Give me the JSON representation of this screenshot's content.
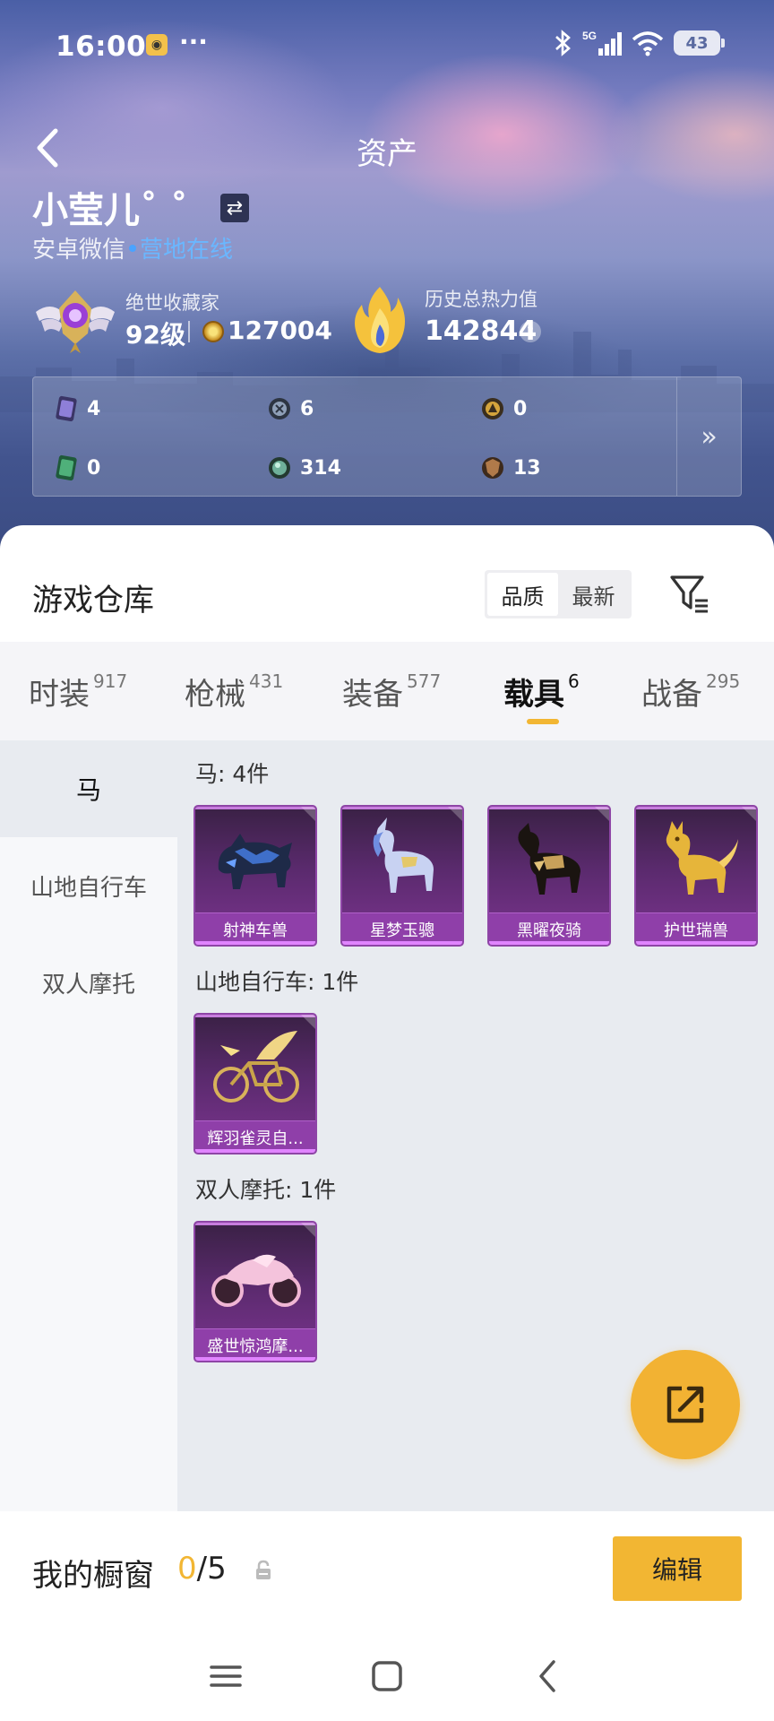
{
  "status_bar": {
    "time": "16:00",
    "dots": "···",
    "battery": "43",
    "network": "5G"
  },
  "header": {
    "title": "资产",
    "username": "小莹儿˚ ˚",
    "platform": "安卓微信",
    "online_status": "营地在线",
    "rank_title": "绝世收藏家",
    "level": "92级",
    "coins": "127004",
    "heat_label": "历史总热力值",
    "heat_value": "142844",
    "help": "?"
  },
  "assets": [
    {
      "icon": "purple-card-icon",
      "value": "4"
    },
    {
      "icon": "silver-emblem-icon",
      "value": "6"
    },
    {
      "icon": "gold-emblem-icon",
      "value": "0"
    },
    {
      "icon": "green-card-icon",
      "value": "0"
    },
    {
      "icon": "green-orb-icon",
      "value": "314"
    },
    {
      "icon": "bronze-shield-icon",
      "value": "13"
    }
  ],
  "assets_more": "»",
  "warehouse": {
    "title": "游戏仓库",
    "sort_options": [
      "品质",
      "最新"
    ],
    "sort_selected": "品质"
  },
  "tabs": [
    {
      "label": "时装",
      "count": "917"
    },
    {
      "label": "枪械",
      "count": "431"
    },
    {
      "label": "装备",
      "count": "577"
    },
    {
      "label": "载具",
      "count": "6"
    },
    {
      "label": "战备",
      "count": "295"
    }
  ],
  "active_tab": "载具",
  "sidebar": [
    "马",
    "山地自行车",
    "双人摩托"
  ],
  "groups": [
    {
      "title": "马: 4件",
      "items": [
        "射神车兽",
        "星梦玉骢",
        "黑曜夜骑",
        "护世瑞兽"
      ]
    },
    {
      "title": "山地自行车: 1件",
      "items": [
        "辉羽雀灵自..."
      ]
    },
    {
      "title": "双人摩托: 1件",
      "items": [
        "盛世惊鸿摩..."
      ]
    }
  ],
  "showcase": {
    "label": "我的橱窗",
    "current": "0",
    "total": "/5",
    "edit_label": "编辑"
  },
  "colors": {
    "accent": "#f2b633",
    "item_purple": "#8f3fa9",
    "online_blue": "#6ab7ff"
  }
}
